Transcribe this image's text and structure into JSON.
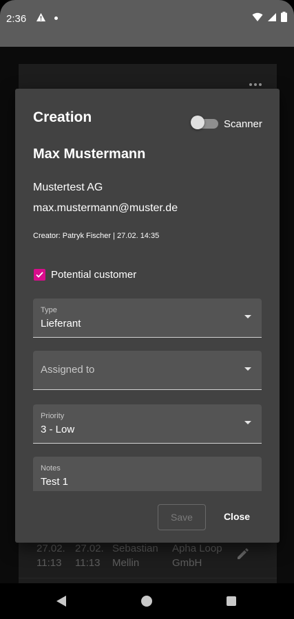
{
  "status_bar": {
    "time": "2:36"
  },
  "background": {
    "row": {
      "col1": [
        "27.02.",
        "11:13"
      ],
      "col2": [
        "27.02.",
        "11:13"
      ],
      "col3": [
        "Sebastian",
        "Mellin"
      ],
      "col4": [
        "Apha Loop",
        "GmbH"
      ]
    }
  },
  "dialog": {
    "title": "Creation",
    "scanner_label": "Scanner",
    "scanner_enabled": false,
    "name": "Max Mustermann",
    "company": "Mustertest AG",
    "email": "max.mustermann@muster.de",
    "creator": "Creator: Patryk Fischer | 27.02. 14:35",
    "potential_customer": {
      "label": "Potential customer",
      "checked": true
    },
    "type_field": {
      "label": "Type",
      "value": "Lieferant"
    },
    "assigned_field": {
      "placeholder": "Assigned to"
    },
    "priority_field": {
      "label": "Priority",
      "value": "3 - Low"
    },
    "notes_field": {
      "label": "Notes",
      "value": "Test 1"
    },
    "save_label": "Save",
    "close_label": "Close"
  },
  "colors": {
    "accent": "#d90c8c",
    "dialog_bg": "#424242",
    "field_bg": "#545454"
  }
}
